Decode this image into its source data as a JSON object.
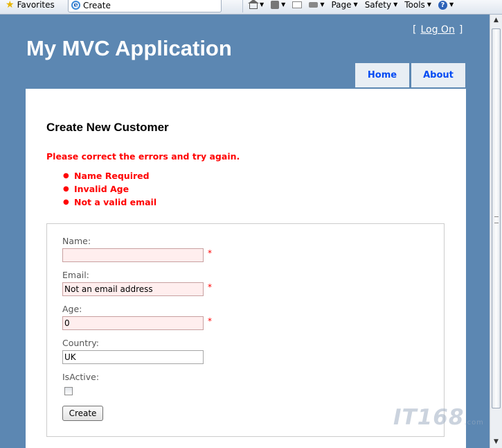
{
  "browser": {
    "favorites_label": "Favorites",
    "tab_title": "Create",
    "tools": {
      "page_label": "Page",
      "safety_label": "Safety",
      "tools_label": "Tools"
    }
  },
  "header": {
    "logon_label": "Log On",
    "site_title": "My MVC Application",
    "menu": [
      {
        "label": "Home"
      },
      {
        "label": "About"
      }
    ]
  },
  "main": {
    "title": "Create New Customer",
    "error_summary": "Please correct the errors and try again.",
    "errors": [
      "Name Required",
      "Invalid Age",
      "Not a valid email"
    ],
    "form": {
      "name": {
        "label": "Name:",
        "value": "",
        "marker": "*"
      },
      "email": {
        "label": "Email:",
        "value": "Not an email address",
        "marker": "*"
      },
      "age": {
        "label": "Age:",
        "value": "0",
        "marker": "*"
      },
      "country": {
        "label": "Country:",
        "value": "UK"
      },
      "isactive": {
        "label": "IsActive:",
        "checked": false
      },
      "submit_label": "Create"
    }
  },
  "watermark": {
    "text": "IT168",
    "suffix": ".com"
  },
  "colors": {
    "page_bg": "#5c87b2",
    "error_text": "#ff0000",
    "error_input_bg": "#ffeeee",
    "menu_link": "#034af3"
  }
}
